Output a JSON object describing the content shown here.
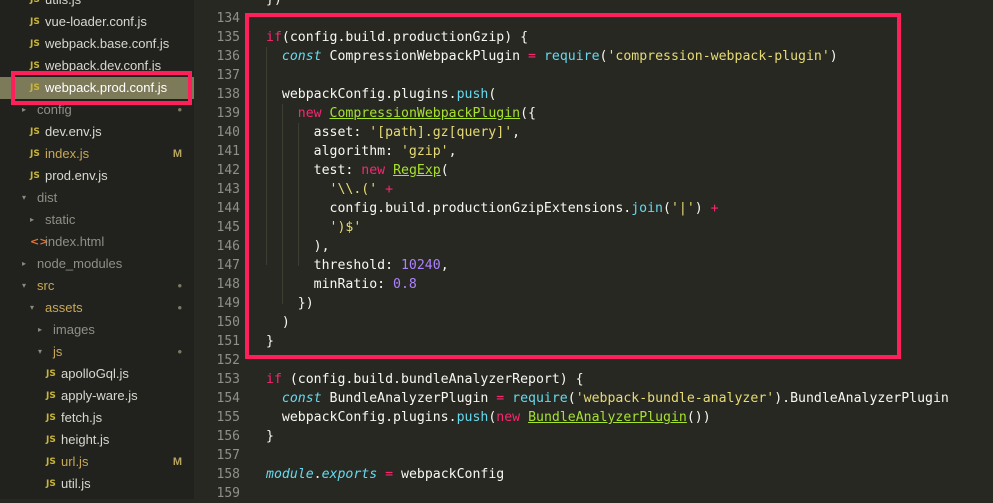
{
  "sidebar": {
    "items": [
      {
        "label": "utils.js",
        "icon": "JS",
        "type": "js",
        "indent": 30,
        "mark": ""
      },
      {
        "label": "vue-loader.conf.js",
        "icon": "JS",
        "type": "js",
        "indent": 30,
        "mark": ""
      },
      {
        "label": "webpack.base.conf.js",
        "icon": "JS",
        "type": "js",
        "indent": 30,
        "mark": ""
      },
      {
        "label": "webpack.dev.conf.js",
        "icon": "JS",
        "type": "js",
        "indent": 30,
        "mark": ""
      },
      {
        "label": "webpack.prod.conf.js",
        "icon": "JS",
        "type": "js-selected",
        "indent": 30,
        "mark": ""
      },
      {
        "label": "config",
        "icon": "▸",
        "type": "folder",
        "indent": 22,
        "mark": "•"
      },
      {
        "label": "dev.env.js",
        "icon": "JS",
        "type": "js",
        "indent": 30,
        "mark": ""
      },
      {
        "label": "index.js",
        "icon": "JS",
        "type": "js-mod",
        "indent": 30,
        "mark": "M"
      },
      {
        "label": "prod.env.js",
        "icon": "JS",
        "type": "js",
        "indent": 30,
        "mark": ""
      },
      {
        "label": "dist",
        "icon": "▾",
        "type": "folder",
        "indent": 22,
        "mark": ""
      },
      {
        "label": "static",
        "icon": "▸",
        "type": "folder",
        "indent": 30,
        "mark": ""
      },
      {
        "label": "index.html",
        "icon": "<>",
        "type": "html",
        "indent": 30,
        "mark": ""
      },
      {
        "label": "node_modules",
        "icon": "▸",
        "type": "folder",
        "indent": 22,
        "mark": ""
      },
      {
        "label": "src",
        "icon": "▾",
        "type": "folder-mod",
        "indent": 22,
        "mark": "•"
      },
      {
        "label": "assets",
        "icon": "▾",
        "type": "folder-mod",
        "indent": 30,
        "mark": "•"
      },
      {
        "label": "images",
        "icon": "▸",
        "type": "folder-plain",
        "indent": 38,
        "mark": ""
      },
      {
        "label": "js",
        "icon": "▾",
        "type": "folder-mod",
        "indent": 38,
        "mark": "•"
      },
      {
        "label": "apolloGql.js",
        "icon": "JS",
        "type": "js",
        "indent": 46,
        "mark": ""
      },
      {
        "label": "apply-ware.js",
        "icon": "JS",
        "type": "js",
        "indent": 46,
        "mark": ""
      },
      {
        "label": "fetch.js",
        "icon": "JS",
        "type": "js",
        "indent": 46,
        "mark": ""
      },
      {
        "label": "height.js",
        "icon": "JS",
        "type": "js",
        "indent": 46,
        "mark": ""
      },
      {
        "label": "url.js",
        "icon": "JS",
        "type": "js-mod",
        "indent": 46,
        "mark": "M"
      },
      {
        "label": "util.js",
        "icon": "JS",
        "type": "js",
        "indent": 46,
        "mark": ""
      }
    ]
  },
  "editor": {
    "first_line_partial": "})",
    "lines": [
      {
        "n": "134",
        "t": []
      },
      {
        "n": "135",
        "t": [
          [
            "kw",
            "if"
          ],
          [
            "",
            "(config.build.productionGzip) {"
          ]
        ]
      },
      {
        "n": "136",
        "t": [
          [
            "",
            "  "
          ],
          [
            "it",
            "const"
          ],
          [
            "",
            " CompressionWebpackPlugin "
          ],
          [
            "kw",
            "="
          ],
          [
            "",
            " "
          ],
          [
            "fn",
            "require"
          ],
          [
            "",
            "("
          ],
          [
            "st",
            "'compression-webpack-plugin'"
          ],
          [
            "",
            ")"
          ]
        ]
      },
      {
        "n": "137",
        "t": []
      },
      {
        "n": "138",
        "t": [
          [
            "",
            "  webpackConfig.plugins."
          ],
          [
            "fn",
            "push"
          ],
          [
            "",
            "("
          ]
        ]
      },
      {
        "n": "139",
        "t": [
          [
            "",
            "    "
          ],
          [
            "kw",
            "new"
          ],
          [
            "",
            " "
          ],
          [
            "cls",
            "CompressionWebpackPlugin"
          ],
          [
            "",
            "({"
          ]
        ]
      },
      {
        "n": "140",
        "t": [
          [
            "",
            "      asset: "
          ],
          [
            "st",
            "'[path].gz[query]'"
          ],
          [
            "",
            ","
          ]
        ]
      },
      {
        "n": "141",
        "t": [
          [
            "",
            "      algorithm: "
          ],
          [
            "st",
            "'gzip'"
          ],
          [
            "",
            ","
          ]
        ]
      },
      {
        "n": "142",
        "t": [
          [
            "",
            "      test: "
          ],
          [
            "kw",
            "new"
          ],
          [
            "",
            " "
          ],
          [
            "cls",
            "RegExp"
          ],
          [
            "",
            "("
          ]
        ]
      },
      {
        "n": "143",
        "t": [
          [
            "",
            "        "
          ],
          [
            "st",
            "'\\\\.('"
          ],
          [
            "",
            " "
          ],
          [
            "kw",
            "+"
          ]
        ]
      },
      {
        "n": "144",
        "t": [
          [
            "",
            "        config.build.productionGzipExtensions."
          ],
          [
            "fn",
            "join"
          ],
          [
            "",
            "("
          ],
          [
            "st",
            "'|'"
          ],
          [
            "",
            ") "
          ],
          [
            "kw",
            "+"
          ]
        ]
      },
      {
        "n": "145",
        "t": [
          [
            "",
            "        "
          ],
          [
            "st",
            "')$'"
          ]
        ]
      },
      {
        "n": "146",
        "t": [
          [
            "",
            "      ),"
          ]
        ]
      },
      {
        "n": "147",
        "t": [
          [
            "",
            "      threshold: "
          ],
          [
            "nm",
            "10240"
          ],
          [
            "",
            ","
          ]
        ]
      },
      {
        "n": "148",
        "t": [
          [
            "",
            "      minRatio: "
          ],
          [
            "nm",
            "0.8"
          ]
        ]
      },
      {
        "n": "149",
        "t": [
          [
            "",
            "    })"
          ]
        ]
      },
      {
        "n": "150",
        "t": [
          [
            "",
            "  )"
          ]
        ]
      },
      {
        "n": "151",
        "t": [
          [
            "",
            "}"
          ]
        ]
      },
      {
        "n": "152",
        "t": []
      },
      {
        "n": "153",
        "t": [
          [
            "kw",
            "if"
          ],
          [
            "",
            " (config.build.bundleAnalyzerReport) {"
          ]
        ]
      },
      {
        "n": "154",
        "t": [
          [
            "",
            "  "
          ],
          [
            "it",
            "const"
          ],
          [
            "",
            " BundleAnalyzerPlugin "
          ],
          [
            "kw",
            "="
          ],
          [
            "",
            " "
          ],
          [
            "fn",
            "require"
          ],
          [
            "",
            "("
          ],
          [
            "st",
            "'webpack-bundle-analyzer'"
          ],
          [
            "",
            ").BundleAnalyzerPlugin"
          ]
        ]
      },
      {
        "n": "155",
        "t": [
          [
            "",
            "  webpackConfig.plugins."
          ],
          [
            "fn",
            "push"
          ],
          [
            "",
            "("
          ],
          [
            "kw",
            "new"
          ],
          [
            "",
            " "
          ],
          [
            "cls",
            "BundleAnalyzerPlugin"
          ],
          [
            "",
            "())"
          ]
        ]
      },
      {
        "n": "156",
        "t": [
          [
            "",
            "}"
          ]
        ]
      },
      {
        "n": "157",
        "t": []
      },
      {
        "n": "158",
        "t": [
          [
            "it",
            "module"
          ],
          [
            "",
            "."
          ],
          [
            "it",
            "exports"
          ],
          [
            "",
            " "
          ],
          [
            "kw",
            "="
          ],
          [
            "",
            " webpackConfig"
          ]
        ]
      },
      {
        "n": "159",
        "t": []
      }
    ]
  },
  "colors": {
    "highlight_border": "#ff1f5a",
    "editor_bg": "#272822",
    "sidebar_bg": "#21221d"
  }
}
